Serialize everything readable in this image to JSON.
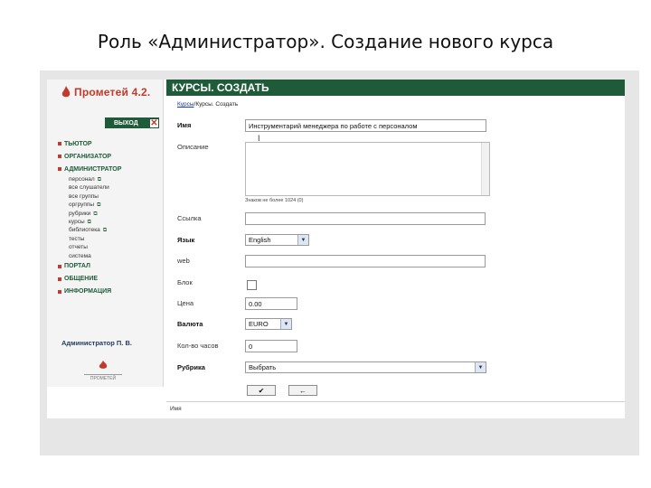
{
  "slide": {
    "title": "Роль «Администратор». Создание нового курса"
  },
  "sidebar": {
    "logo": "Прометей 4.2.",
    "exit": "ВЫХОД",
    "close_glyph": "✕",
    "menu": [
      {
        "label": "ТЬЮТОР"
      },
      {
        "label": "ОРГАНИЗАТОР"
      },
      {
        "label": "АДМИНИСТРАТОР"
      }
    ],
    "submenu": [
      {
        "label": "персонал",
        "mark": "⧉"
      },
      {
        "label": "все слушатели",
        "mark": ""
      },
      {
        "label": "все группы",
        "mark": ""
      },
      {
        "label": "оргруппы",
        "mark": "⧉"
      },
      {
        "label": "рубрики",
        "mark": "⧉"
      },
      {
        "label": "курсы",
        "mark": "⧉"
      },
      {
        "label": "библиотека",
        "mark": "⧉"
      },
      {
        "label": "тесты",
        "mark": ""
      },
      {
        "label": "отчеты",
        "mark": ""
      },
      {
        "label": "система",
        "mark": ""
      }
    ],
    "menu2": [
      {
        "label": "ПОРТАЛ"
      },
      {
        "label": "ОБЩЕНИЕ"
      },
      {
        "label": "ИНФОРМАЦИЯ"
      }
    ],
    "admin_name": "Администратор П. В.",
    "small_logo": "ПРОМЕТЕЙ"
  },
  "main": {
    "header": "КУРСЫ. СОЗДАТЬ",
    "breadcrumb_link": "Курсы",
    "breadcrumb_rest": "/Курсы. Создать",
    "fields": {
      "name_label": "Имя",
      "name_value": "Инструментарий менеджера по работе с персоналом",
      "description_label": "Описание",
      "description_hint": "Знаков не более 1024 (0)",
      "link_label": "Ссылка",
      "language_label": "Язык",
      "language_value": "English",
      "web_label": "web",
      "block_label": "Блок",
      "price_label": "Цена",
      "price_value": "0.00",
      "currency_label": "Валюта",
      "currency_value": "EURO",
      "hours_label": "Кол-во часов",
      "hours_value": "0",
      "rubric_label": "Рубрика",
      "rubric_value": "Выбрать"
    },
    "buttons": {
      "ok_glyph": "✔",
      "back_glyph": "←"
    },
    "footer": "Имя"
  },
  "icons": [
    "flame-icon",
    "close-icon",
    "checkmark-icon",
    "back-arrow-icon",
    "dropdown-arrow-icon"
  ],
  "colors": {
    "header_green": "#1f5a39",
    "logo_red": "#c33a2c"
  }
}
